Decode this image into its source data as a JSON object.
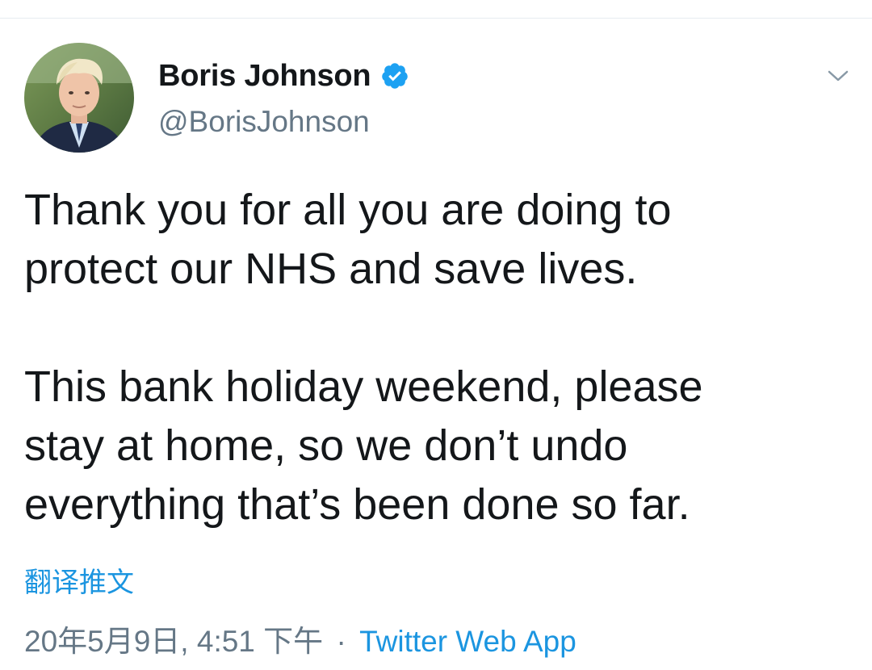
{
  "author": {
    "display_name": "Boris Johnson",
    "handle": "@BorisJohnson",
    "verified": true
  },
  "tweet": {
    "text": "Thank you for all you are doing to\nprotect our NHS and save lives.\n\nThis bank holiday weekend, please\nstay at home, so we don’t undo\neverything that’s been done so far."
  },
  "translate_label": "翻译推文",
  "meta": {
    "timestamp": "20年5月9日, 4:51 下午",
    "separator": "·",
    "source": "Twitter Web App"
  },
  "colors": {
    "link": "#1b95e0",
    "muted": "#657786",
    "text": "#14171a",
    "verified": "#1da1f2"
  },
  "icons": {
    "verified": "verified-badge-icon",
    "menu": "chevron-down-icon"
  }
}
